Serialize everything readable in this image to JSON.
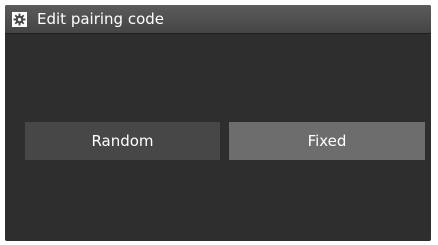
{
  "header": {
    "title": "Edit pairing code",
    "icon": "settings-gear-icon"
  },
  "options": {
    "random_label": "Random",
    "fixed_label": "Fixed",
    "selected": "Fixed"
  },
  "colors": {
    "screen_background": "#2e2e2e",
    "title_bar": "#4f4f4f",
    "unselected_button": "#474747",
    "selected_button": "#6d6d6d",
    "text": "#ffffff"
  }
}
